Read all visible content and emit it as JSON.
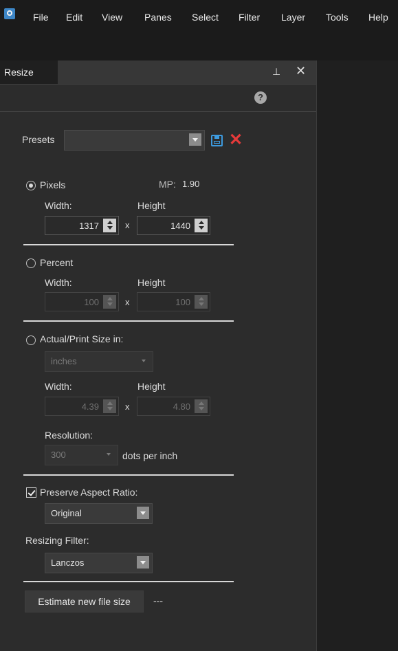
{
  "menu": [
    "File",
    "Edit",
    "View",
    "Panes",
    "Select",
    "Filter",
    "Layer",
    "Tools",
    "Help"
  ],
  "panel": {
    "title": "Resize",
    "pin_glyph": "⊥",
    "close_glyph": "✕",
    "help_glyph": "?"
  },
  "presets": {
    "label": "Presets",
    "value": ""
  },
  "pixels": {
    "label": "Pixels",
    "selected": true,
    "mp_label": "MP:",
    "mp_value": "1.90",
    "width_label": "Width:",
    "height_label": "Height",
    "width": "1317",
    "height": "1440"
  },
  "percent": {
    "label": "Percent",
    "selected": false,
    "width_label": "Width:",
    "height_label": "Height",
    "width": "100",
    "height": "100"
  },
  "actual": {
    "label": "Actual/Print Size in:",
    "selected": false,
    "unit": "inches",
    "width_label": "Width:",
    "height_label": "Height",
    "width": "4.39",
    "height": "4.80",
    "resolution_label": "Resolution:",
    "resolution": "300",
    "resolution_unit": "dots per inch"
  },
  "times_glyph": "x",
  "aspect": {
    "label": "Preserve Aspect Ratio:",
    "checked": true,
    "value": "Original"
  },
  "filter": {
    "label": "Resizing Filter:",
    "value": "Lanczos"
  },
  "estimate": {
    "button": "Estimate new file size",
    "result": "---"
  },
  "colors": {
    "accent": "#3d9bdf",
    "danger": "#e63a3a"
  }
}
